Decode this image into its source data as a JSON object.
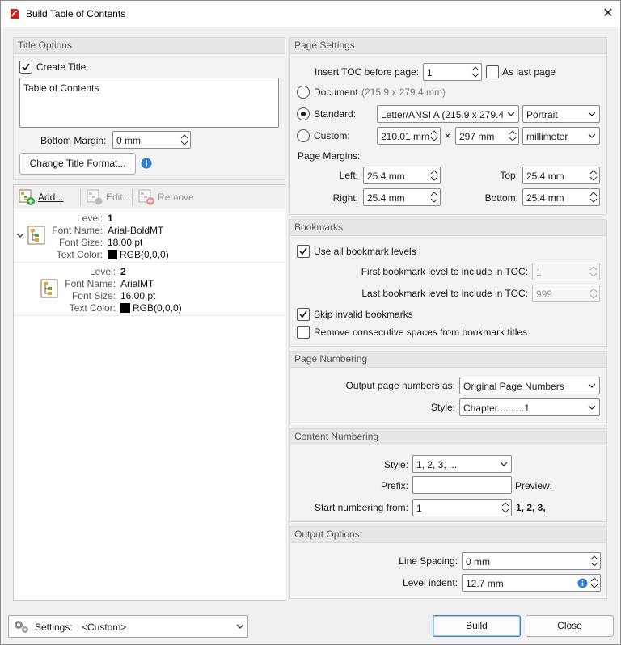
{
  "window": {
    "title": "Build Table of Contents"
  },
  "title_options": {
    "header": "Title Options",
    "create_title_label": "Create Title",
    "create_title_checked": true,
    "title_text": "Table of Contents",
    "bottom_margin_label": "Bottom Margin:",
    "bottom_margin_value": "0 mm",
    "change_format_label": "Change Title Format..."
  },
  "levels": {
    "toolbar": {
      "add_label": "Add...",
      "edit_label": "Edit...",
      "remove_label": "Remove"
    },
    "keys": {
      "level": "Level:",
      "font_name": "Font Name:",
      "font_size": "Font Size:",
      "text_color": "Text Color:"
    },
    "items": [
      {
        "level": "1",
        "font_name": "Arial-BoldMT",
        "font_size": "18.00 pt",
        "text_color": "RGB(0,0,0)",
        "color_hex": "#000000"
      },
      {
        "level": "2",
        "font_name": "ArialMT",
        "font_size": "16.00 pt",
        "text_color": "RGB(0,0,0)",
        "color_hex": "#000000"
      }
    ]
  },
  "page_settings": {
    "header": "Page Settings",
    "insert_before_label": "Insert TOC before page:",
    "insert_before_value": "1",
    "as_last_page_label": "As last page",
    "document_label": "Document",
    "document_size": "(215.9 x 279.4 mm)",
    "standard_label": "Standard:",
    "standard_value": "Letter/ANSI A (215.9 x 279.4 m",
    "orientation_value": "Portrait",
    "custom_label": "Custom:",
    "custom_width": "210.01 mm",
    "times": "×",
    "custom_height": "297 mm",
    "unit_value": "millimeter",
    "margins_label": "Page Margins:",
    "left_label": "Left:",
    "left_value": "25.4 mm",
    "top_label": "Top:",
    "top_value": "25.4 mm",
    "right_label": "Right:",
    "right_value": "25.4 mm",
    "bottom_label": "Bottom:",
    "bottom_value": "25.4 mm"
  },
  "bookmarks": {
    "header": "Bookmarks",
    "use_all_label": "Use all bookmark levels",
    "first_level_label": "First bookmark level to include in TOC:",
    "first_level_value": "1",
    "last_level_label": "Last bookmark level to include in TOC:",
    "last_level_value": "999",
    "skip_invalid_label": "Skip invalid bookmarks",
    "remove_spaces_label": "Remove consecutive spaces from bookmark titles"
  },
  "page_numbering": {
    "header": "Page Numbering",
    "output_label": "Output page numbers as:",
    "output_value": "Original Page Numbers",
    "style_label": "Style:",
    "style_value": "Chapter..........1"
  },
  "content_numbering": {
    "header": "Content Numbering",
    "style_label": "Style:",
    "style_value": "1, 2, 3, ...",
    "prefix_label": "Prefix:",
    "prefix_value": "",
    "preview_label": "Preview:",
    "start_label": "Start numbering from:",
    "start_value": "1",
    "preview_value": "1, 2, 3,"
  },
  "output_options": {
    "header": "Output Options",
    "line_spacing_label": "Line Spacing:",
    "line_spacing_value": "0 mm",
    "level_indent_label": "Level indent:",
    "level_indent_value": "12.7 mm"
  },
  "footer": {
    "settings_label": "Settings:",
    "settings_value": "<Custom>",
    "build_label": "Build",
    "close_label": "Close"
  },
  "colors": {
    "accent": "#3b86c8",
    "info": "#2f7fd6",
    "app_red": "#c8231e"
  }
}
